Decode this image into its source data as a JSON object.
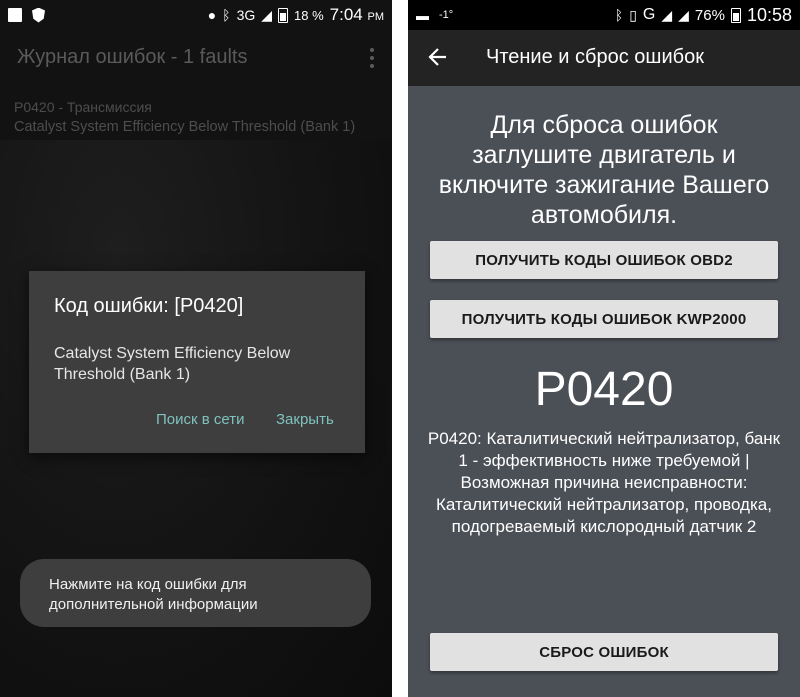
{
  "left": {
    "status": {
      "network": "3G",
      "battery": "18 %",
      "time": "7:04",
      "ampm": "PM"
    },
    "app_title": "Журнал ошибок - 1 faults",
    "fault": {
      "code_line": "P0420 - Трансмиссия",
      "desc_line": "Catalyst System Efficiency Below Threshold (Bank 1)"
    },
    "dialog": {
      "title": "Код ошибки: [P0420]",
      "message": "Catalyst System Efficiency Below Threshold (Bank 1)",
      "search_label": "Поиск в сети",
      "close_label": "Закрыть"
    },
    "toast": "Нажмите на код ошибки для дополнительной информации"
  },
  "right": {
    "status": {
      "temp": "-1°",
      "network": "G",
      "battery": "76%",
      "time": "10:58"
    },
    "title": "Чтение и сброс ошибок",
    "instruction": "Для сброса ошибок заглушите двигатель и включите зажигание Вашего автомобиля.",
    "btn_obd2": "ПОЛУЧИТЬ КОДЫ ОШИБОК OBD2",
    "btn_kwp2000": "ПОЛУЧИТЬ КОДЫ ОШИБОК KWP2000",
    "code": "P0420",
    "description": "P0420: Каталитический нейтрализатор, банк 1 - эффективность ниже требуемой | Возможная причина неисправности: Каталитический нейтрализатор, проводка, подогреваемый кислородный датчик 2",
    "btn_reset": "СБРОС ОШИБОК"
  },
  "colors": {
    "accent_teal": "#7fc2bd",
    "dialog_bg": "#3e3e3e",
    "right_bg": "#4b4f56",
    "button_bg": "#e1e1e1"
  }
}
